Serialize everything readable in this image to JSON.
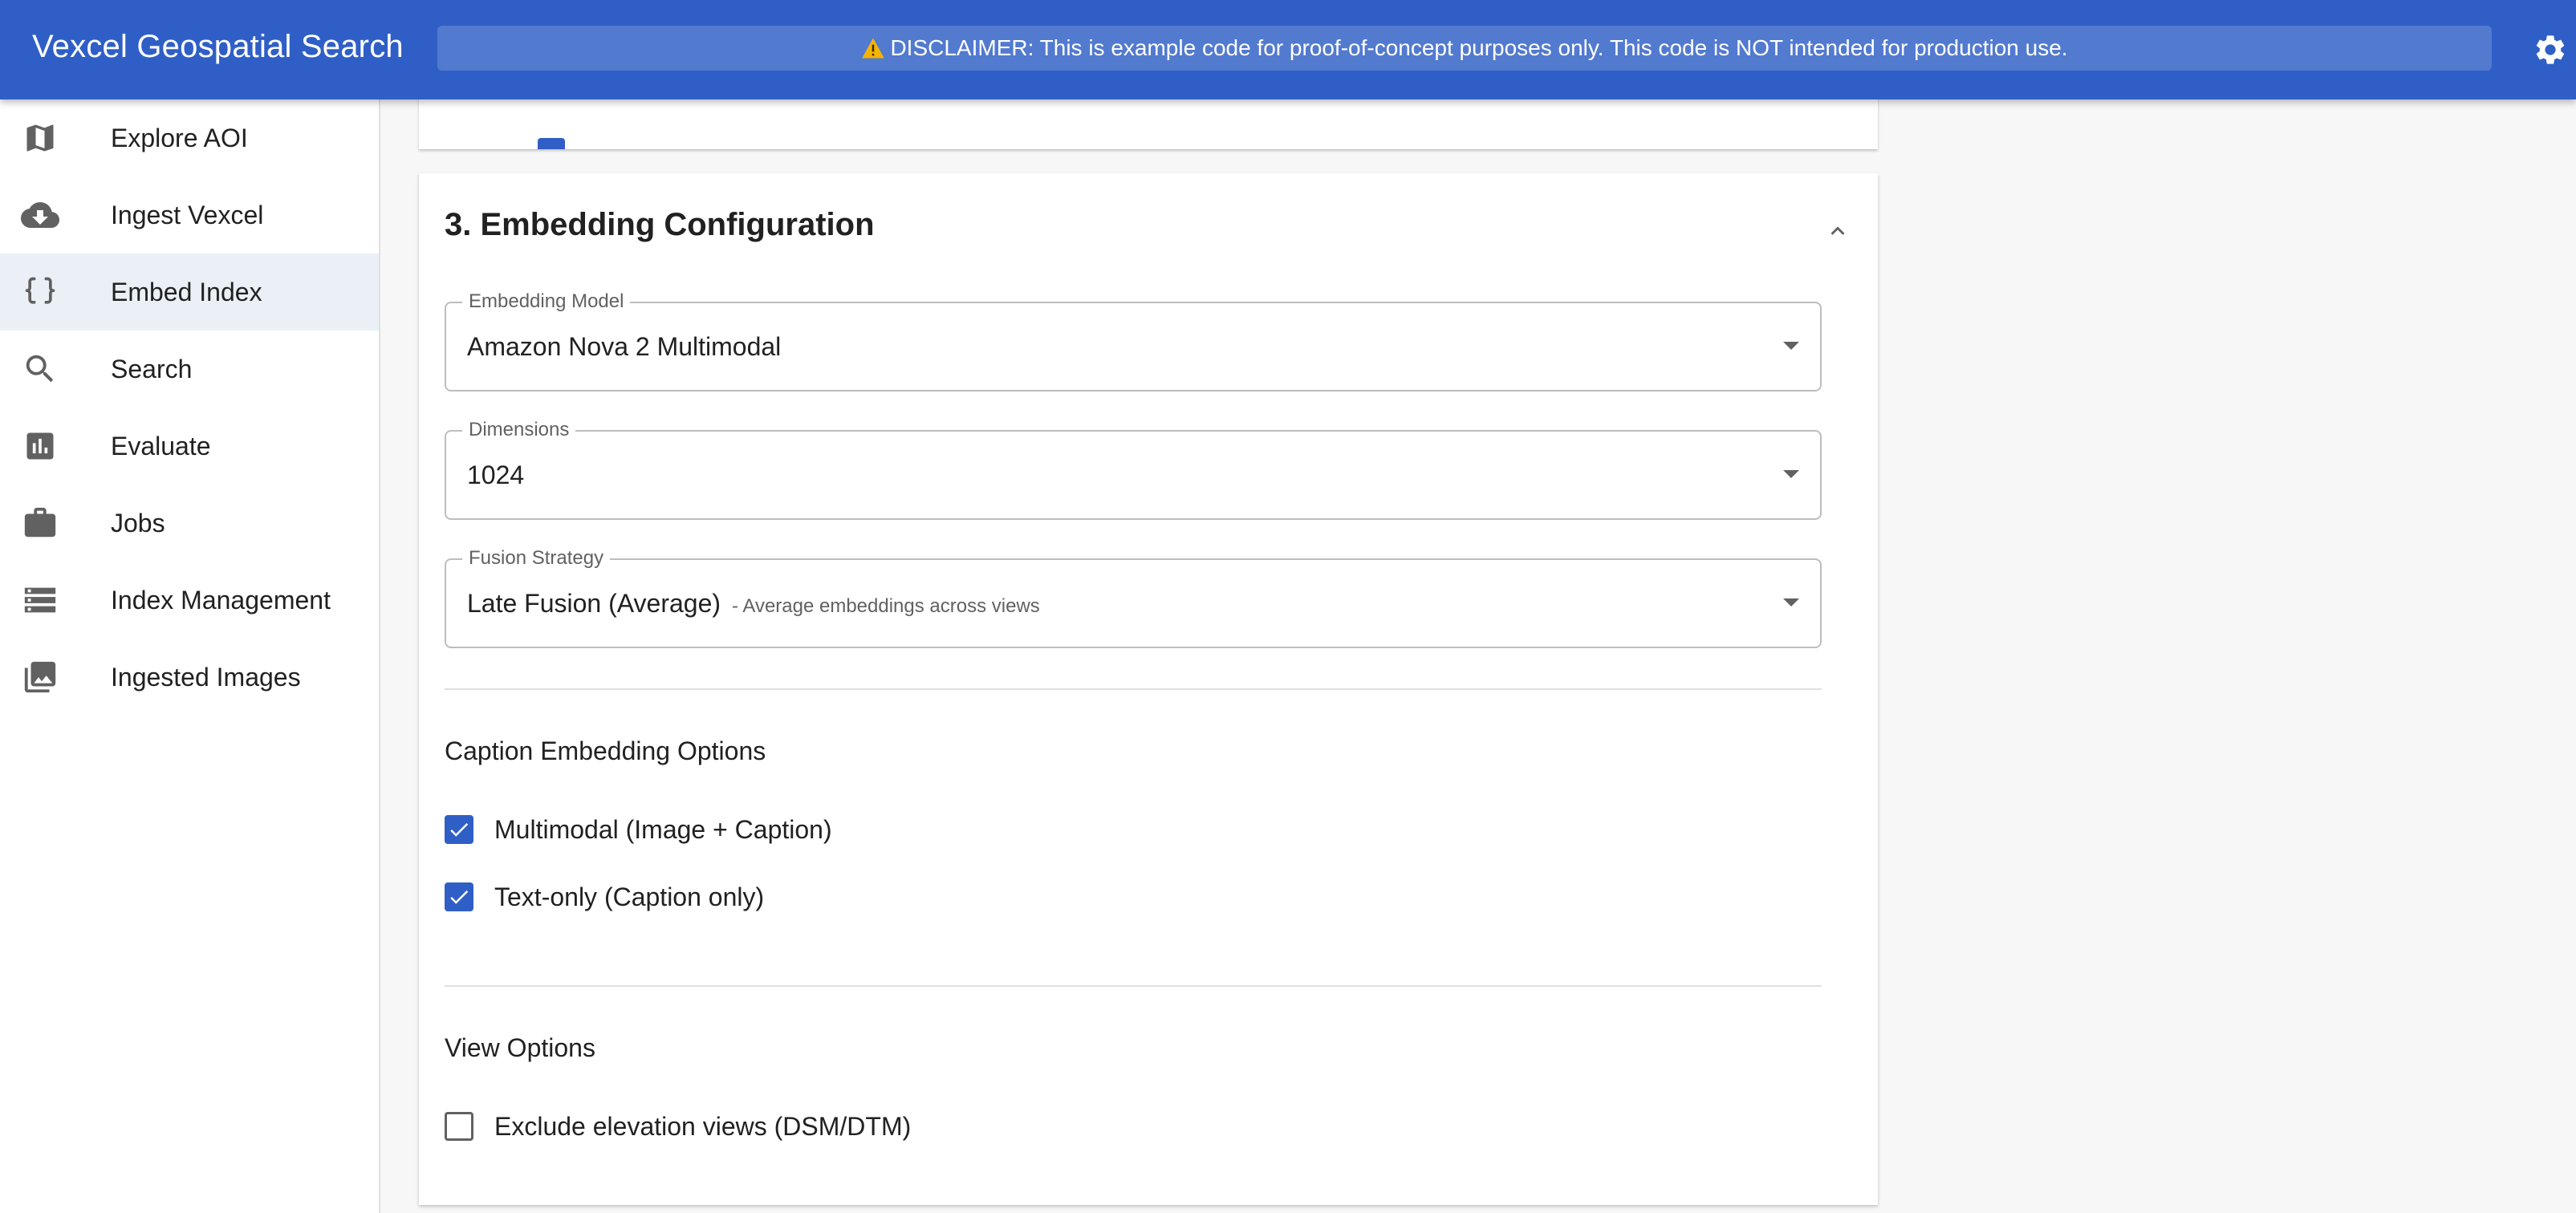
{
  "app": {
    "title": "Vexcel Geospatial Search",
    "disclaimer": "DISCLAIMER: This is example code for proof-of-concept purposes only. This code is NOT intended for production use.",
    "brand_color": "#2f5fc6",
    "warning_color": "#f5b400"
  },
  "sidebar": {
    "active": "Embed Index",
    "items": [
      {
        "label": "Explore AOI",
        "icon": "map-icon"
      },
      {
        "label": "Ingest Vexcel",
        "icon": "cloud-download-icon"
      },
      {
        "label": "Embed Index",
        "icon": "code-braces-icon"
      },
      {
        "label": "Search",
        "icon": "search-icon"
      },
      {
        "label": "Evaluate",
        "icon": "bar-chart-icon"
      },
      {
        "label": "Jobs",
        "icon": "briefcase-icon"
      },
      {
        "label": "Index Management",
        "icon": "storage-icon"
      },
      {
        "label": "Ingested Images",
        "icon": "image-library-icon"
      }
    ]
  },
  "embedding_section": {
    "title": "3. Embedding Configuration",
    "expanded": true,
    "model": {
      "label": "Embedding Model",
      "value": "Amazon Nova 2 Multimodal"
    },
    "dimensions": {
      "label": "Dimensions",
      "value": "1024"
    },
    "fusion": {
      "label": "Fusion Strategy",
      "value": "Late Fusion (Average)",
      "hint": "- Average embeddings across views"
    },
    "caption_options": {
      "title": "Caption Embedding Options",
      "multimodal": {
        "label": "Multimodal (Image + Caption)",
        "checked": true
      },
      "text_only": {
        "label": "Text-only (Caption only)",
        "checked": true
      }
    },
    "view_options": {
      "title": "View Options",
      "exclude_elevation": {
        "label": "Exclude elevation views (DSM/DTM)",
        "checked": false
      }
    }
  }
}
